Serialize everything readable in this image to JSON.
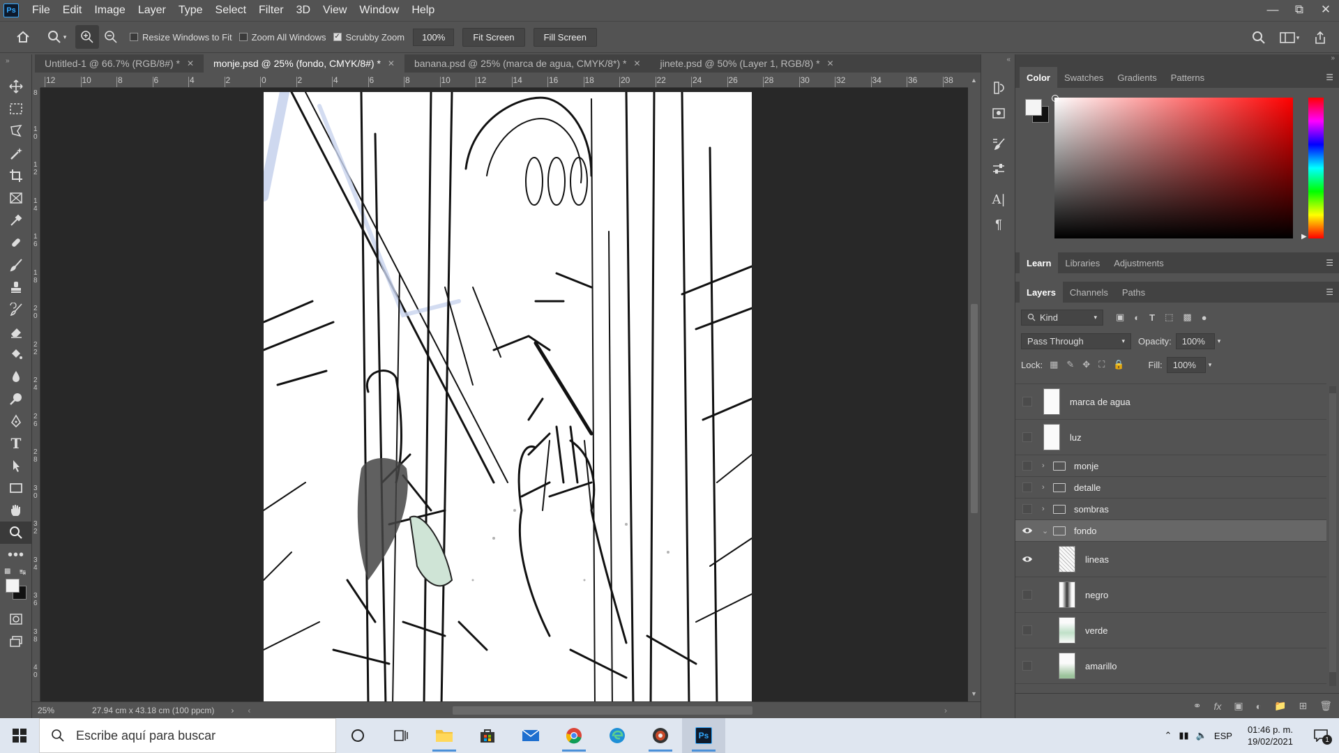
{
  "app": {
    "logo": "Ps"
  },
  "menu": [
    "File",
    "Edit",
    "Image",
    "Layer",
    "Type",
    "Select",
    "Filter",
    "3D",
    "View",
    "Window",
    "Help"
  ],
  "window_controls": {
    "minimize": "minimize-icon",
    "restore": "restore-icon",
    "close": "close-icon"
  },
  "options": {
    "resize_windows": {
      "label": "Resize Windows to Fit",
      "checked": false
    },
    "zoom_all": {
      "label": "Zoom All Windows",
      "checked": false
    },
    "scrubby_zoom": {
      "label": "Scrubby Zoom",
      "checked": true
    },
    "zoom_value": "100%",
    "fit_screen": "Fit Screen",
    "fill_screen": "Fill Screen"
  },
  "tabs": [
    {
      "label": "Untitled-1 @ 66.7% (RGB/8#) *",
      "active": false
    },
    {
      "label": "monje.psd @ 25% (fondo, CMYK/8#) *",
      "active": true
    },
    {
      "label": "banana.psd @ 25% (marca de agua, CMYK/8*) *",
      "active": false
    },
    {
      "label": "jinete.psd @ 50% (Layer 1, RGB/8) *",
      "active": false
    }
  ],
  "ruler_h": [
    "12",
    "10",
    "8",
    "6",
    "4",
    "2",
    "0",
    "2",
    "4",
    "6",
    "8",
    "10",
    "12",
    "14",
    "16",
    "18",
    "20",
    "22",
    "24",
    "26",
    "28",
    "30",
    "32",
    "34",
    "36",
    "38"
  ],
  "ruler_v": [
    "8",
    "10",
    "12",
    "14",
    "16",
    "18",
    "20",
    "22",
    "24",
    "26",
    "28",
    "30",
    "32",
    "34",
    "36",
    "38",
    "40"
  ],
  "status": {
    "zoom": "25%",
    "doc_info": "27.94 cm x 43.18 cm (100 ppcm)"
  },
  "color_panel": {
    "tabs": [
      "Color",
      "Swatches",
      "Gradients",
      "Patterns"
    ],
    "active": "Color",
    "foreground": "#f4f4f4",
    "background": "#111111"
  },
  "learn_panel": {
    "tabs": [
      "Learn",
      "Libraries",
      "Adjustments"
    ],
    "active": "Learn"
  },
  "layers_panel": {
    "tabs": [
      "Layers",
      "Channels",
      "Paths"
    ],
    "active": "Layers",
    "filter_kind": "Kind",
    "blend_mode": "Pass Through",
    "opacity_label": "Opacity:",
    "opacity": "100%",
    "lock_label": "Lock:",
    "fill_label": "Fill:",
    "fill": "100%",
    "layers": [
      {
        "name": "marca de agua",
        "type": "layer",
        "visible": false,
        "indent": 0
      },
      {
        "name": "luz",
        "type": "layer",
        "visible": false,
        "indent": 0
      },
      {
        "name": "monje",
        "type": "group",
        "visible": false,
        "expanded": false,
        "indent": 0
      },
      {
        "name": "detalle",
        "type": "group",
        "visible": false,
        "expanded": false,
        "indent": 0
      },
      {
        "name": "sombras",
        "type": "group",
        "visible": false,
        "expanded": false,
        "indent": 0
      },
      {
        "name": "fondo",
        "type": "group",
        "visible": true,
        "expanded": true,
        "indent": 0,
        "active": true
      },
      {
        "name": "lineas",
        "type": "layer",
        "visible": true,
        "indent": 1
      },
      {
        "name": "negro",
        "type": "layer",
        "visible": false,
        "indent": 1
      },
      {
        "name": "verde",
        "type": "layer",
        "visible": false,
        "indent": 1
      },
      {
        "name": "amarillo",
        "type": "layer",
        "visible": false,
        "indent": 1
      }
    ]
  },
  "taskbar": {
    "search_placeholder": "Escribe aquí para buscar",
    "apps": [
      "cortana-icon",
      "task-view-icon",
      "file-explorer-icon",
      "store-icon",
      "mail-icon",
      "chrome-icon",
      "edge-icon",
      "media-icon",
      "photoshop-icon"
    ],
    "language": "ESP",
    "time": "01:46 p. m.",
    "date": "19/02/2021"
  }
}
